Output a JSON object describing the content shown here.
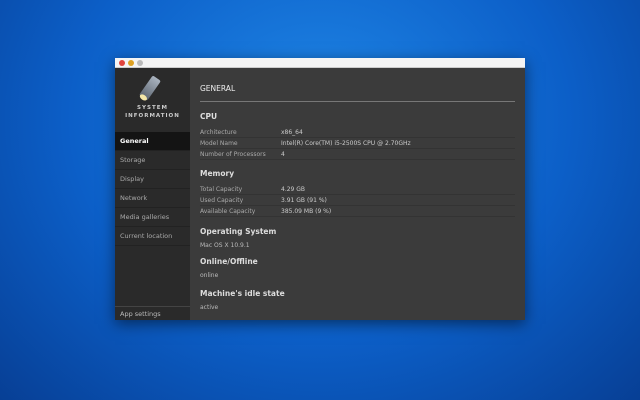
{
  "sidebar": {
    "logo_line1": "SYSTEM",
    "logo_line2": "INFORMATION",
    "items": [
      "General",
      "Storage",
      "Display",
      "Network",
      "Media galleries",
      "Current location"
    ],
    "app_settings": "App settings"
  },
  "main": {
    "title": "GENERAL",
    "cpu": {
      "heading": "CPU",
      "rows": [
        [
          "Architecture",
          "x86_64"
        ],
        [
          "Model Name",
          "Intel(R) Core(TM) i5-2500S CPU @ 2.70GHz"
        ],
        [
          "Number of Processors",
          "4"
        ]
      ]
    },
    "memory": {
      "heading": "Memory",
      "rows": [
        [
          "Total Capacity",
          "4.29 GB"
        ],
        [
          "Used Capacity",
          "3.91 GB (91 %)"
        ],
        [
          "Available Capacity",
          "385.09 MB (9 %)"
        ]
      ]
    },
    "os": {
      "heading": "Operating System",
      "value": "Mac OS X 10.9.1"
    },
    "online": {
      "heading": "Online/Offline",
      "value": "online"
    },
    "idle": {
      "heading": "Machine's idle state",
      "value": "active"
    }
  }
}
